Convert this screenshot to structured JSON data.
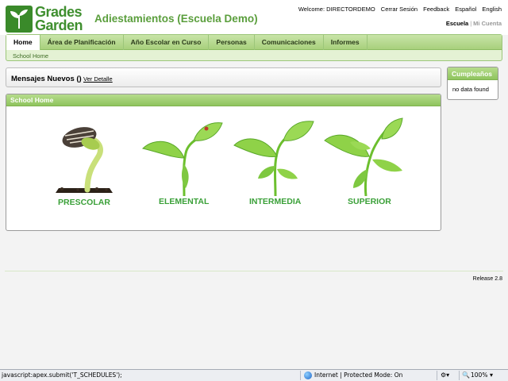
{
  "header": {
    "logo_line1": "Grades",
    "logo_line2": "Garden",
    "app_title": "Adiestamientos (Escuela Demo)",
    "welcome": "Welcome: DIRECTORDEMO",
    "links": [
      "Cerrar Sesión",
      "Feedback",
      "Español",
      "English"
    ],
    "scope_active": "Escuela",
    "scope_separator": "|",
    "scope_inactive": "Mi Cuenta"
  },
  "nav": {
    "tabs": [
      "Home",
      "Área de Planificación",
      "Año Escolar en Curso",
      "Personas",
      "Comunicaciones",
      "Informes"
    ],
    "active_tab": "Home",
    "breadcrumb": "School Home"
  },
  "messages": {
    "title": "Mensajes Nuevos ()",
    "link": "Ver Detalle"
  },
  "school_home": {
    "title": "School Home",
    "levels": [
      "PRESCOLAR",
      "ELEMENTAL",
      "INTERMEDIA",
      "SUPERIOR"
    ]
  },
  "birthdays": {
    "title": "Cumpleaños",
    "empty_text": "no data found"
  },
  "footer": {
    "release": "Release 2.8"
  },
  "statusbar": {
    "left_text": "javascript:apex.submit('T_SCHEDULES');",
    "zone": "Internet | Protected Mode: On",
    "zoom": "100%"
  },
  "colors": {
    "brand_green": "#3f8f2f",
    "title_green": "#5a9e3c",
    "level_label_green": "#3aa038"
  }
}
